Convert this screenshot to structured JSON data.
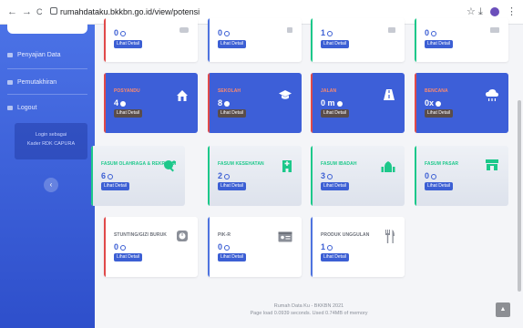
{
  "browser": {
    "back": "←",
    "forward": "→",
    "reload": "C",
    "url": "rumahdataku.bkkbn.go.id/view/potensi",
    "star": "☆",
    "download": "⤓",
    "menu": "⋮"
  },
  "sidebar": {
    "items": [
      {
        "label": "Penyajian Data"
      },
      {
        "label": "Pemutakhiran"
      },
      {
        "label": "Logout"
      }
    ],
    "login_line1": "Login sebagai",
    "login_line2": "Kader RDK CAPURA",
    "collapse": "‹"
  },
  "cards_top": [
    {
      "value": "0",
      "button": "Lihat Detail"
    },
    {
      "value": "0",
      "button": "Lihat Detail"
    },
    {
      "value": "1",
      "button": "Lihat Detail"
    },
    {
      "value": "0",
      "button": "Lihat Detail"
    }
  ],
  "cards_row1": [
    {
      "label": "POSYANDU",
      "value": "4",
      "button": "Lihat Detail",
      "icon": "house-icon"
    },
    {
      "label": "SEKOLAH",
      "value": "8",
      "button": "Lihat Detail",
      "icon": "graduation-cap-icon"
    },
    {
      "label": "JALAN",
      "value": "0 m",
      "button": "Lihat Detail",
      "icon": "road-icon"
    },
    {
      "label": "BENCANA",
      "value": "0x",
      "button": "Lihat Detail",
      "icon": "cloud-rain-icon"
    }
  ],
  "cards_row2": [
    {
      "label": "FASUM OLAHRAGA & REKREASI",
      "value": "6",
      "button": "Lihat Detail",
      "icon": "ping-pong-icon"
    },
    {
      "label": "FASUM KESEHATAN",
      "value": "2",
      "button": "Lihat Detail",
      "icon": "hospital-icon"
    },
    {
      "label": "FASUM IBADAH",
      "value": "3",
      "button": "Lihat Detail",
      "icon": "mosque-icon"
    },
    {
      "label": "FASUM PASAR",
      "value": "0",
      "button": "Lihat Detail",
      "icon": "store-icon"
    }
  ],
  "cards_row3": [
    {
      "label": "STUNTING/GIZI BURUK",
      "value": "0",
      "button": "Lihat Detail",
      "icon": "scale-icon"
    },
    {
      "label": "PIK-R",
      "value": "0",
      "button": "Lihat Detail",
      "icon": "id-card-icon"
    },
    {
      "label": "PRODUK UNGGULAN",
      "value": "1",
      "button": "Lihat Detail",
      "icon": "utensils-icon"
    }
  ],
  "colors": {
    "blue": "#3c5fd4",
    "red_bar": "#e04a4a",
    "green_bar": "#1cc88a",
    "blue_bar": "#4e73df",
    "icon_green": "#1cc88a",
    "icon_grey": "#8b8f98"
  },
  "footer": {
    "line1": "Rumah Data Ku - BKKBN 2021",
    "line2": "Page load 0.0939 seconds. Used 0.74MB of memory"
  },
  "scroll_top": "▲"
}
